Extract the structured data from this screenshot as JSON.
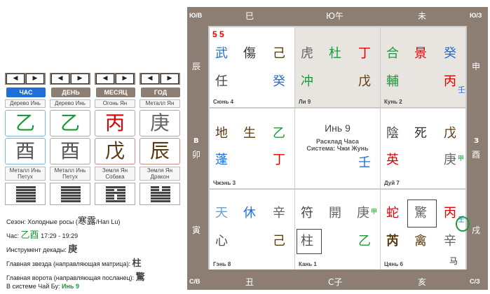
{
  "nav": {
    "prev": "◀",
    "next": "▶"
  },
  "tabs": [
    "ЧАС",
    "ДЕНЬ",
    "МЕСЯЦ",
    "ГОД"
  ],
  "stem_labels": [
    "Дерево Инь",
    "Дерево Инь",
    "Огонь Ян",
    "Металл Ян"
  ],
  "stems": [
    "乙",
    "乙",
    "丙",
    "庚"
  ],
  "branches": [
    "酉",
    "酉",
    "戊",
    "辰"
  ],
  "branch_labels": [
    {
      "l1": "Металл Инь",
      "l2": "Петух"
    },
    {
      "l1": "Металл Инь",
      "l2": "Петух"
    },
    {
      "l1": "Земля Ян",
      "l2": "Собака"
    },
    {
      "l1": "Земля Ян",
      "l2": "Дракон"
    }
  ],
  "info": {
    "season_label": "Сезон: Холодные росы (",
    "season_hanzi": "寒露",
    "season_tail": "/Han Lu)",
    "hour_label": "Час:",
    "hour_hanzi": "乙酉",
    "hour_time": "17:29 - 19:29",
    "decade_label": "Инструмент декады:",
    "decade_val": "庚",
    "star_label": "Главная звезда (направляющая матрица):",
    "star_val": "柱",
    "gate_label": "Главная ворота (направляющая посланец):",
    "gate_val": "驚",
    "system_label": "В системе Чай Бу:",
    "system_val": "Инь 9"
  },
  "frame": {
    "top": [
      "巳",
      "Ю午",
      "未"
    ],
    "bottom": [
      "丑",
      "С子",
      "亥"
    ],
    "left": [
      "辰",
      "В",
      "卯",
      "寅"
    ],
    "right": [
      "申",
      "З",
      "酉",
      "戌"
    ],
    "corners": {
      "nw": "Ю/В",
      "ne": "Ю/З",
      "sw": "С/В",
      "se": "С/З"
    }
  },
  "cells": {
    "c1": {
      "num": "5 5",
      "r1": [
        "武",
        "傷",
        "己"
      ],
      "r2": [
        "任",
        "",
        "癸"
      ],
      "name": "Сюнь 4"
    },
    "c2": {
      "r1": [
        "虎",
        "杜",
        "丁"
      ],
      "r2": [
        "冲",
        "",
        "戊"
      ],
      "name": "Ли 9"
    },
    "c3": {
      "r1": [
        "合",
        "景",
        "癸"
      ],
      "r2": [
        "輔",
        "",
        "丙"
      ],
      "sup": "壬",
      "name": "Кунь 2"
    },
    "c4": {
      "r1": [
        "地",
        "生",
        "乙"
      ],
      "r2": [
        "蓬",
        "",
        "丁"
      ],
      "name": "Чжэнь 3"
    },
    "c5": {
      "title": "Инь 9",
      "sub1": "Расклад Часа",
      "sub2": "Система: Чжи Жунь",
      "stem": "壬"
    },
    "c6": {
      "r1": [
        "陰",
        "死",
        "戊"
      ],
      "r2": [
        "英",
        "",
        "庚"
      ],
      "sup": "甲",
      "name": "Дуй 7"
    },
    "c7": {
      "r1": [
        "天",
        "休",
        "辛"
      ],
      "r2": [
        "心",
        "",
        "己"
      ],
      "name": "Гэнь 8"
    },
    "c8": {
      "r1": [
        "符",
        "開",
        "庚"
      ],
      "sup": "甲",
      "r2": [
        "柱",
        "",
        "乙"
      ],
      "name": "Кань 1"
    },
    "c9": {
      "r1": [
        "蛇",
        "驚",
        "丙"
      ],
      "sup": "壬",
      "r2": [
        "芮",
        "禽",
        "辛"
      ],
      "extra": "马",
      "name": "Цянь 6"
    }
  }
}
